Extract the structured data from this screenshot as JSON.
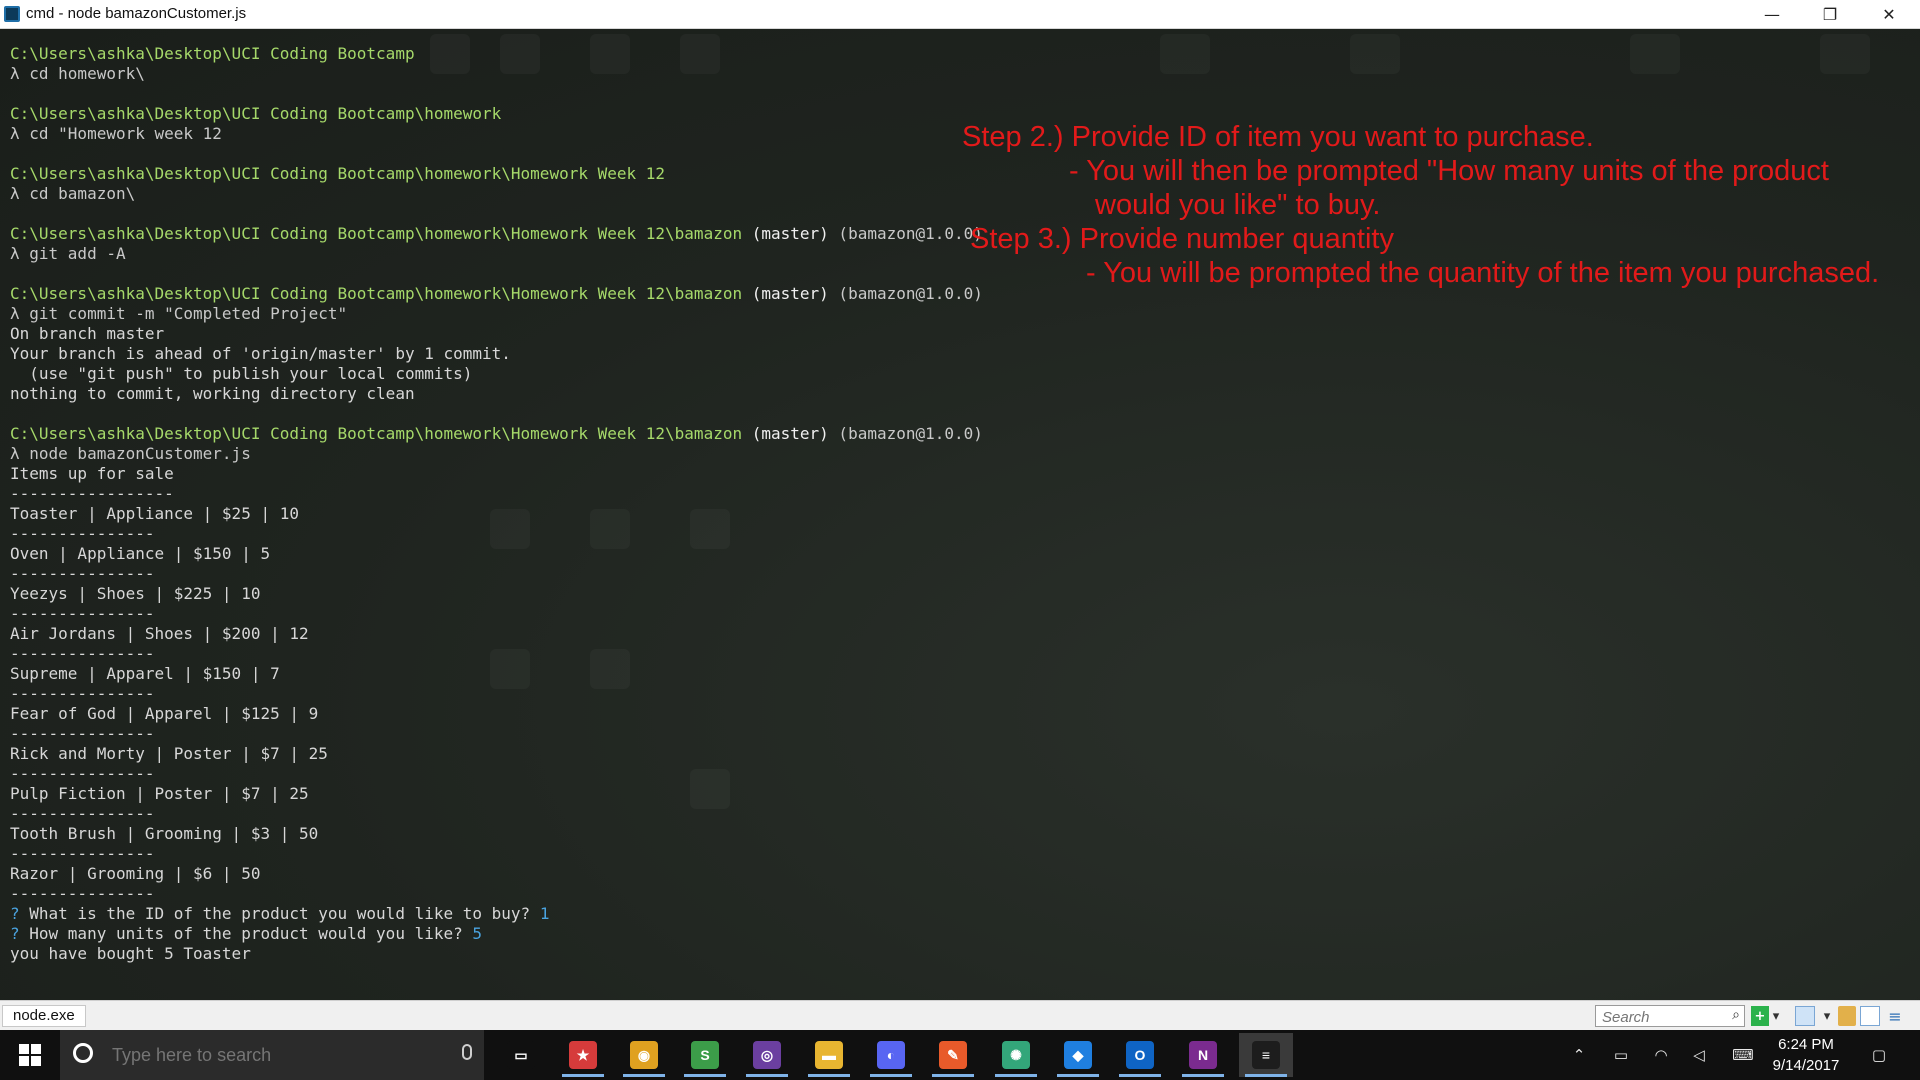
{
  "window": {
    "title": "cmd - node  bamazonCustomer.js",
    "minimize_glyph": "—",
    "restore_glyph": "❐",
    "close_glyph": "✕"
  },
  "terminal": {
    "lines": [
      [
        {
          "c": "path",
          "t": "C:\\Users\\ashka\\Desktop\\UCI Coding Bootcamp"
        }
      ],
      [
        {
          "c": "lambda",
          "t": "λ cd homework\\"
        }
      ],
      [],
      [
        {
          "c": "path",
          "t": "C:\\Users\\ashka\\Desktop\\UCI Coding Bootcamp\\homework"
        }
      ],
      [
        {
          "c": "lambda",
          "t": "λ cd \"Homework week 12"
        }
      ],
      [],
      [
        {
          "c": "path",
          "t": "C:\\Users\\ashka\\Desktop\\UCI Coding Bootcamp\\homework\\Homework Week 12"
        }
      ],
      [
        {
          "c": "lambda",
          "t": "λ cd bamazon\\"
        }
      ],
      [],
      [
        {
          "c": "path",
          "t": "C:\\Users\\ashka\\Desktop\\UCI Coding Bootcamp\\homework\\Homework Week 12\\bamazon"
        },
        {
          "c": "branch",
          "t": " (master)"
        },
        {
          "c": "pkg",
          "t": " (bamazon@1.0.0)"
        }
      ],
      [
        {
          "c": "lambda",
          "t": "λ git add -A"
        }
      ],
      [],
      [
        {
          "c": "path",
          "t": "C:\\Users\\ashka\\Desktop\\UCI Coding Bootcamp\\homework\\Homework Week 12\\bamazon"
        },
        {
          "c": "branch",
          "t": " (master)"
        },
        {
          "c": "pkg",
          "t": " (bamazon@1.0.0)"
        }
      ],
      [
        {
          "c": "lambda",
          "t": "λ git commit -m \"Completed Project\""
        }
      ],
      [
        {
          "c": "out",
          "t": "On branch master"
        }
      ],
      [
        {
          "c": "out",
          "t": "Your branch is ahead of 'origin/master' by 1 commit."
        }
      ],
      [
        {
          "c": "out",
          "t": "  (use \"git push\" to publish your local commits)"
        }
      ],
      [
        {
          "c": "out",
          "t": "nothing to commit, working directory clean"
        }
      ],
      [],
      [
        {
          "c": "path",
          "t": "C:\\Users\\ashka\\Desktop\\UCI Coding Bootcamp\\homework\\Homework Week 12\\bamazon"
        },
        {
          "c": "branch",
          "t": " (master)"
        },
        {
          "c": "pkg",
          "t": " (bamazon@1.0.0)"
        }
      ],
      [
        {
          "c": "lambda",
          "t": "λ node bamazonCustomer.js"
        }
      ],
      [
        {
          "c": "out",
          "t": "Items up for sale"
        }
      ],
      [
        {
          "c": "out",
          "t": "-----------------"
        }
      ],
      [
        {
          "c": "out",
          "t": "Toaster | Appliance | $25 | 10"
        }
      ],
      [
        {
          "c": "out",
          "t": "---------------"
        }
      ],
      [
        {
          "c": "out",
          "t": "Oven | Appliance | $150 | 5"
        }
      ],
      [
        {
          "c": "out",
          "t": "---------------"
        }
      ],
      [
        {
          "c": "out",
          "t": "Yeezys | Shoes | $225 | 10"
        }
      ],
      [
        {
          "c": "out",
          "t": "---------------"
        }
      ],
      [
        {
          "c": "out",
          "t": "Air Jordans | Shoes | $200 | 12"
        }
      ],
      [
        {
          "c": "out",
          "t": "---------------"
        }
      ],
      [
        {
          "c": "out",
          "t": "Supreme | Apparel | $150 | 7"
        }
      ],
      [
        {
          "c": "out",
          "t": "---------------"
        }
      ],
      [
        {
          "c": "out",
          "t": "Fear of God | Apparel | $125 | 9"
        }
      ],
      [
        {
          "c": "out",
          "t": "---------------"
        }
      ],
      [
        {
          "c": "out",
          "t": "Rick and Morty | Poster | $7 | 25"
        }
      ],
      [
        {
          "c": "out",
          "t": "---------------"
        }
      ],
      [
        {
          "c": "out",
          "t": "Pulp Fiction | Poster | $7 | 25"
        }
      ],
      [
        {
          "c": "out",
          "t": "---------------"
        }
      ],
      [
        {
          "c": "out",
          "t": "Tooth Brush | Grooming | $3 | 50"
        }
      ],
      [
        {
          "c": "out",
          "t": "---------------"
        }
      ],
      [
        {
          "c": "out",
          "t": "Razor | Grooming | $6 | 50"
        }
      ],
      [
        {
          "c": "out",
          "t": "---------------"
        }
      ],
      [
        {
          "c": "q",
          "t": "? "
        },
        {
          "c": "out",
          "t": "What is the ID of the product you would like to buy? "
        },
        {
          "c": "ans",
          "t": "1"
        }
      ],
      [
        {
          "c": "q",
          "t": "? "
        },
        {
          "c": "out",
          "t": "How many units of the product would you like? "
        },
        {
          "c": "ans",
          "t": "5"
        }
      ],
      [
        {
          "c": "out",
          "t": "you have bought 5 Toaster"
        }
      ]
    ],
    "annotations": [
      "Step 2.) Provide ID of item you want to purchase.",
      "- You will then be prompted \"How many units of the product",
      "would you like\" to buy.",
      "Step 3.) Provide number quantity",
      "- You will be prompted the quantity of the item you purchased."
    ],
    "annotation_color": "#e21a1a"
  },
  "statusbar": {
    "tab_label": "node.exe",
    "search_placeholder": "Search"
  },
  "taskbar": {
    "search_placeholder": "Type here to search",
    "apps": [
      {
        "name": "task-view",
        "color": "#101010",
        "glyph": "▭"
      },
      {
        "name": "wps-app",
        "color": "#d63b3b",
        "glyph": "★"
      },
      {
        "name": "chrome",
        "color": "#e0a120",
        "glyph": "◉"
      },
      {
        "name": "sublime-app",
        "color": "#3c9d49",
        "glyph": "S"
      },
      {
        "name": "color-app",
        "color": "#6b3fa0",
        "glyph": "◎"
      },
      {
        "name": "file-explorer",
        "color": "#e8b531",
        "glyph": "▬"
      },
      {
        "name": "discord",
        "color": "#5865f2",
        "glyph": "◐"
      },
      {
        "name": "feather-app",
        "color": "#e85a2a",
        "glyph": "✎"
      },
      {
        "name": "gitkraken-app",
        "color": "#33a67a",
        "glyph": "✺"
      },
      {
        "name": "dropbox",
        "color": "#1f7fe0",
        "glyph": "◆"
      },
      {
        "name": "outlook",
        "color": "#0f64c4",
        "glyph": "O"
      },
      {
        "name": "onenote",
        "color": "#7b2b8f",
        "glyph": "N"
      },
      {
        "name": "cmder",
        "color": "#1d1d1d",
        "glyph": "≡"
      }
    ],
    "time": "6:24 PM",
    "date": "9/14/2017"
  }
}
